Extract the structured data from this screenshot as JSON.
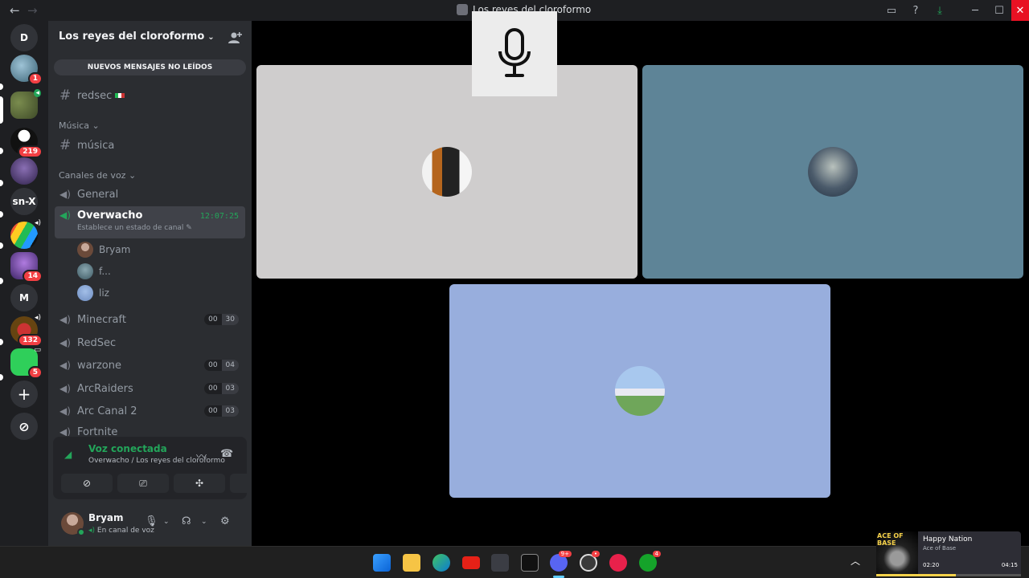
{
  "titlebar": {
    "back": "←",
    "forward": "→",
    "title": "Los reyes del cloroformo"
  },
  "rail": {
    "home_glyph": "D",
    "servers": [
      {
        "badge": "1"
      },
      {
        "badge": ""
      },
      {
        "badge": "219"
      },
      {
        "badge": ""
      },
      {
        "label": "sn-X"
      },
      {
        "badge": ""
      },
      {
        "badge": "14"
      },
      {
        "label": "M"
      },
      {
        "badge": "132"
      },
      {
        "badge": "5"
      }
    ],
    "add_glyph": "+",
    "discover_glyph": "⊘"
  },
  "sidebar": {
    "server_name": "Los reyes del cloroformo",
    "unread_banner": "NUEVOS MENSAJES NO LEÍDOS",
    "text_channels": [
      {
        "name": "redsec"
      }
    ],
    "music_category": "Música",
    "music_channels": [
      {
        "name": "música"
      }
    ],
    "voice_category": "Canales de voz",
    "voice_channels": [
      {
        "name": "General"
      },
      {
        "name": "Overwacho",
        "timer": "12:07:25",
        "status": "Establece un estado de canal"
      },
      {
        "name": "Minecraft",
        "c1": "00",
        "c2": "30"
      },
      {
        "name": "RedSec"
      },
      {
        "name": "warzone",
        "c1": "00",
        "c2": "04"
      },
      {
        "name": "ArcRaiders",
        "c1": "00",
        "c2": "03"
      },
      {
        "name": "Arc Canal 2",
        "c1": "00",
        "c2": "03"
      },
      {
        "name": "Fortnite"
      }
    ],
    "members": [
      {
        "name": "Bryam"
      },
      {
        "name": "f..."
      },
      {
        "name": "liz"
      }
    ]
  },
  "voice_panel": {
    "status": "Voz conectada",
    "location": "Overwacho / Los reyes del cloroformo"
  },
  "user_panel": {
    "name": "Bryam",
    "status": "En canal de voz"
  },
  "colors": {
    "accent_green": "#23a55a",
    "tile1": "#cfcdcd",
    "tile2": "#5e8497",
    "tile3": "#98aedd"
  },
  "media": {
    "brand": "ACE OF BASE",
    "song": "Happy Nation",
    "artist": "Ace of Base",
    "current": "02:20",
    "duration": "04:15",
    "progress": 0.55
  },
  "taskbar": {
    "discord_badge": "9+",
    "xbox_badge": "4"
  }
}
